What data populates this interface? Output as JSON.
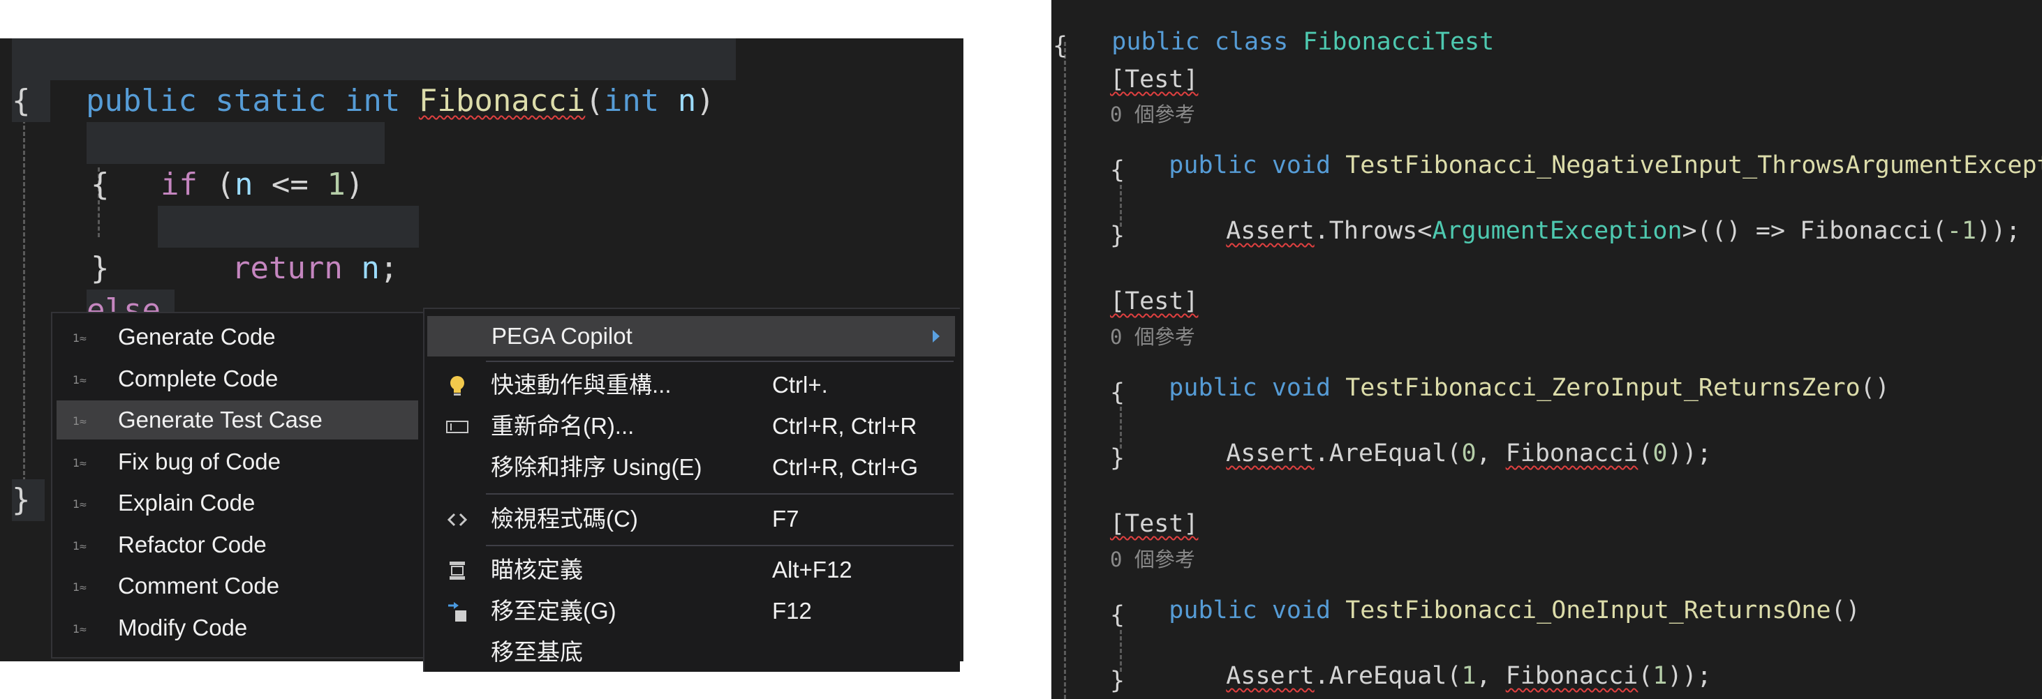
{
  "left_editor": {
    "lines": {
      "sig": {
        "kw1": "public",
        "kw2": "static",
        "kw3": "int",
        "fn": "Fibonacci",
        "p1": "(",
        "kw4": "int",
        "var": "n",
        "p2": ")"
      },
      "brace_open": "{",
      "if_line": {
        "kw": "if",
        "p1": " (",
        "var": "n",
        "op": " <= ",
        "num": "1",
        "p2": ")"
      },
      "inner_open": "{",
      "ret": {
        "kw": "return",
        "var": "n",
        "p": ";"
      },
      "inner_close": "}",
      "else": "else",
      "brace_close": "}"
    }
  },
  "submenu": {
    "items": [
      {
        "label": "Generate Code",
        "icon": "ai-icon"
      },
      {
        "label": "Complete Code",
        "icon": "ai-icon"
      },
      {
        "label": "Generate Test Case",
        "icon": "ai-icon",
        "hovered": true
      },
      {
        "label": "Fix bug of Code",
        "icon": "ai-icon"
      },
      {
        "label": "Explain Code",
        "icon": "ai-icon"
      },
      {
        "label": "Refactor Code",
        "icon": "ai-icon"
      },
      {
        "label": "Comment Code",
        "icon": "ai-icon"
      },
      {
        "label": "Modify Code",
        "icon": "ai-icon"
      }
    ]
  },
  "context_menu": {
    "pega": {
      "label": "PEGA Copilot"
    },
    "quick_actions": {
      "label": "快速動作與重構...",
      "shortcut": "Ctrl+.",
      "icon": "lightbulb-icon"
    },
    "rename": {
      "label": "重新命名(R)...",
      "shortcut": "Ctrl+R, Ctrl+R",
      "icon": "rename-icon"
    },
    "remove_usings": {
      "label": "移除和排序 Using(E)",
      "shortcut": "Ctrl+R, Ctrl+G"
    },
    "view_code": {
      "label": "檢視程式碼(C)",
      "shortcut": "F7",
      "icon": "code-icon"
    },
    "peek_def": {
      "label": "瞄核定義",
      "shortcut": "Alt+F12",
      "icon": "peek-definition-icon"
    },
    "goto_def": {
      "label": "移至定義(G)",
      "shortcut": "F12",
      "icon": "go-to-definition-icon"
    },
    "goto_base": {
      "label": "移至基底"
    }
  },
  "right_editor": {
    "class_line": {
      "kw1": "public",
      "kw2": "class",
      "name": "FibonacciTest"
    },
    "brace": "{",
    "refs": "0 個參考",
    "attr": "[Test]",
    "tests": [
      {
        "sig": {
          "kw1": "public",
          "kw2": "void",
          "name": "TestFibonacci_NegativeInput_ThrowsArgumentException",
          "paren": "()"
        },
        "body": {
          "a": "Assert",
          "b": ".Throws<",
          "c": "ArgumentException",
          "d": ">(() => Fibonacci(",
          "e": "-1",
          "f": "));"
        }
      },
      {
        "sig": {
          "kw1": "public",
          "kw2": "void",
          "name": "TestFibonacci_ZeroInput_ReturnsZero",
          "paren": "()"
        },
        "body": {
          "a": "Assert",
          "b": ".AreEqual(",
          "c": "0",
          "d": ", ",
          "e": "Fibonacci",
          "f": "(",
          "g": "0",
          "h": "));"
        }
      },
      {
        "sig": {
          "kw1": "public",
          "kw2": "void",
          "name": "TestFibonacci_OneInput_ReturnsOne",
          "paren": "()"
        },
        "body": {
          "a": "Assert",
          "b": ".AreEqual(",
          "c": "1",
          "d": ", ",
          "e": "Fibonacci",
          "f": "(",
          "g": "1",
          "h": "));"
        }
      }
    ],
    "open_brace": "{",
    "close_brace": "}"
  },
  "colors": {
    "editor_bg": "#1e1e1e",
    "keyword": "#569cd6",
    "control_keyword": "#c586c0",
    "method": "#dcdcaa",
    "variable": "#9cdcfe",
    "number": "#b5cea8",
    "type": "#4ec9b0",
    "menu_bg": "#1b1b1c",
    "menu_hover": "#3e3e40",
    "submenu_arrow": "#5aa0e0"
  }
}
